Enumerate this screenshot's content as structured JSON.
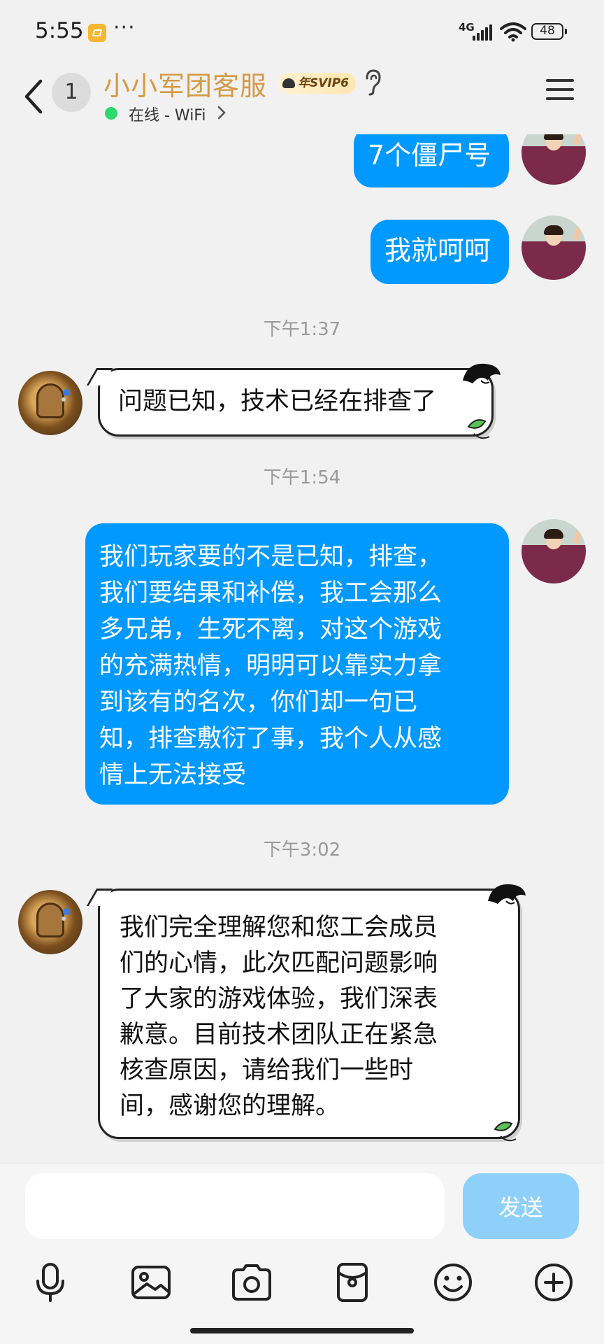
{
  "status_bar": {
    "time": "5:55",
    "more": "···",
    "network": "4G",
    "battery": "48"
  },
  "header": {
    "unread_count": "1",
    "contact_name": "小小军团客服",
    "vip_badge": "年SVIP6",
    "online_status": "在线 - WiFi"
  },
  "messages": [
    {
      "sender": "me",
      "text": "7个僵尸号"
    },
    {
      "sender": "me",
      "text": "我就呵呵"
    },
    {
      "type": "timestamp",
      "text": "下午1:37"
    },
    {
      "sender": "cs",
      "text": "问题已知，技术已经在排查了"
    },
    {
      "type": "timestamp",
      "text": "下午1:54"
    },
    {
      "sender": "me",
      "lines": [
        "我们玩家要的不是已知，排查，",
        "我们要结果和补偿，我工会那么",
        "多兄弟，生死不离，对这个游戏",
        "的充满热情，明明可以靠实力拿",
        "到该有的名次，你们却一句已",
        "知，排查敷衍了事，我个人从感",
        "情上无法接受"
      ]
    },
    {
      "type": "timestamp",
      "text": "下午3:02"
    },
    {
      "sender": "cs",
      "lines": [
        "我们完全理解您和您工会成员",
        "们的心情，此次匹配问题影响",
        "了大家的游戏体验，我们深表",
        "歉意。目前技术团队正在紧急",
        "核查原因，请给我们一些时",
        "间，感谢您的理解。"
      ]
    }
  ],
  "input": {
    "placeholder": "",
    "send_label": "发送"
  },
  "toolbar": [
    "microphone-icon",
    "image-icon",
    "camera-icon",
    "red-packet-icon",
    "emoji-icon",
    "plus-icon"
  ],
  "colors": {
    "accent": "#0099ff",
    "name": "#d59a46",
    "online": "#2bd96d",
    "send_disabled": "#8fd0fb"
  }
}
